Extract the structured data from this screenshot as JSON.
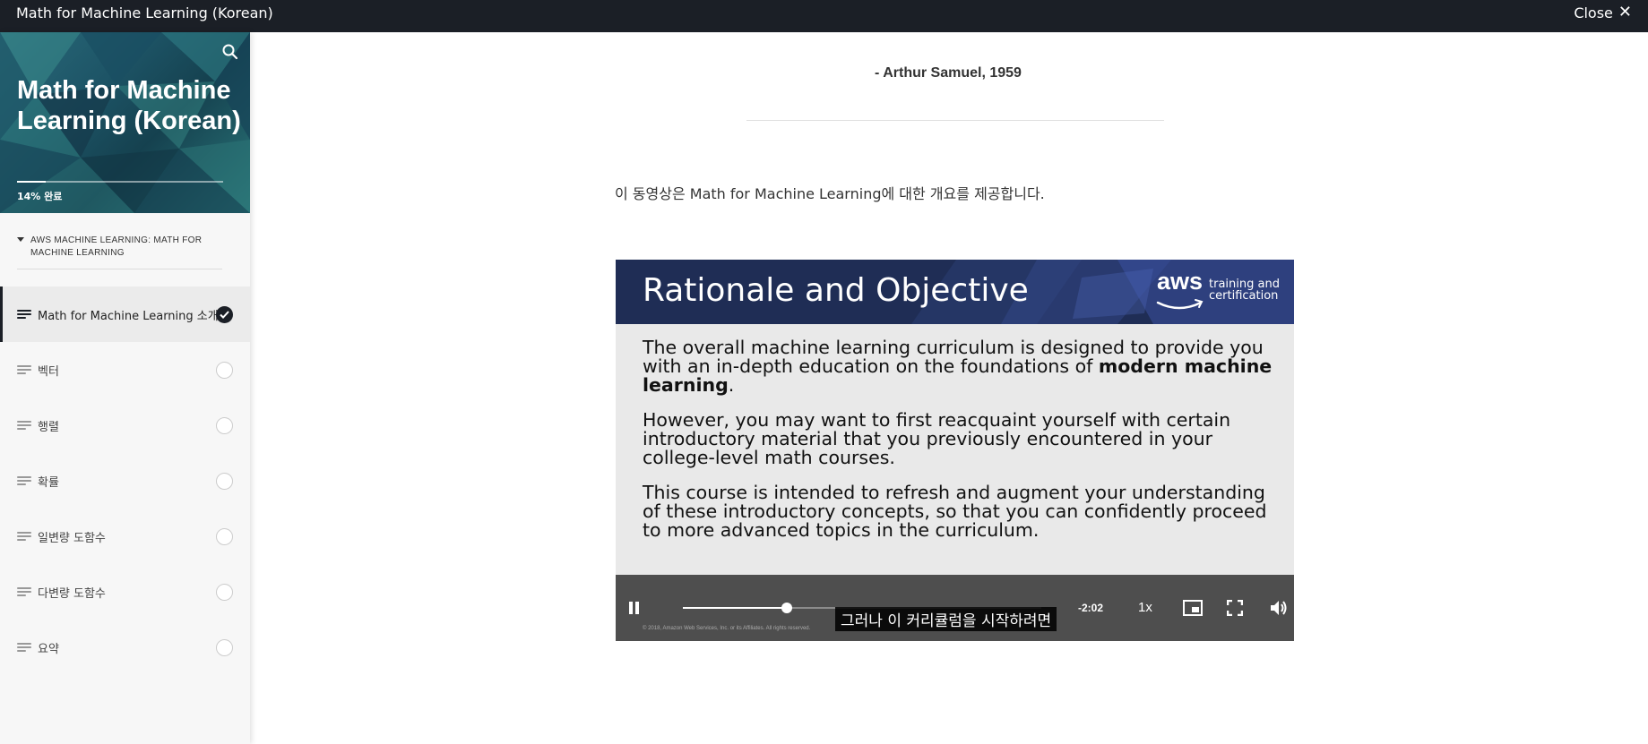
{
  "window": {
    "title": "Math for Machine Learning (Korean)",
    "close_label": "Close"
  },
  "sidebar": {
    "course_title": "Math for Machine Learning (Korean)",
    "progress_label": "14% 완료",
    "progress_fraction": 0.14,
    "section_label": "AWS MACHINE LEARNING: MATH FOR MACHINE LEARNING",
    "lessons": [
      {
        "label": "Math for Machine Learning 소개",
        "completed": true,
        "active": true
      },
      {
        "label": "벡터",
        "completed": false,
        "active": false
      },
      {
        "label": "행렬",
        "completed": false,
        "active": false
      },
      {
        "label": "확률",
        "completed": false,
        "active": false
      },
      {
        "label": "일변량 도함수",
        "completed": false,
        "active": false
      },
      {
        "label": "다변량 도함수",
        "completed": false,
        "active": false
      },
      {
        "label": "요약",
        "completed": false,
        "active": false
      }
    ]
  },
  "main": {
    "quote_attribution": "- Arthur Samuel, 1959",
    "intro_text": "이 동영상은 Math for Machine Learning에 대한 개요를 제공합니다."
  },
  "video": {
    "slide_title": "Rationale and Objective",
    "brand_word": "aws",
    "brand_line1": "training and",
    "brand_line2": "certification",
    "para1_a": "The overall machine learning curriculum is designed to provide you with an in-depth education on the foundations of ",
    "para1_bold": "modern machine learning",
    "para1_end": ".",
    "para2": "However, you may want to first reacquaint yourself with certain introductory material that you previously encountered in your college-level math courses.",
    "para3": "This course is intended to refresh and augment your understanding of these introductory concepts, so that you can confidently proceed to more advanced topics in the curriculum.",
    "copyright": "© 2018, Amazon Web Services, Inc. or its Affiliates. All rights reserved.",
    "caption": "그러나 이 커리큘럼을 시작하려면",
    "time_remaining": "-2:02",
    "speed": "1x",
    "playback_fraction": 0.29
  }
}
